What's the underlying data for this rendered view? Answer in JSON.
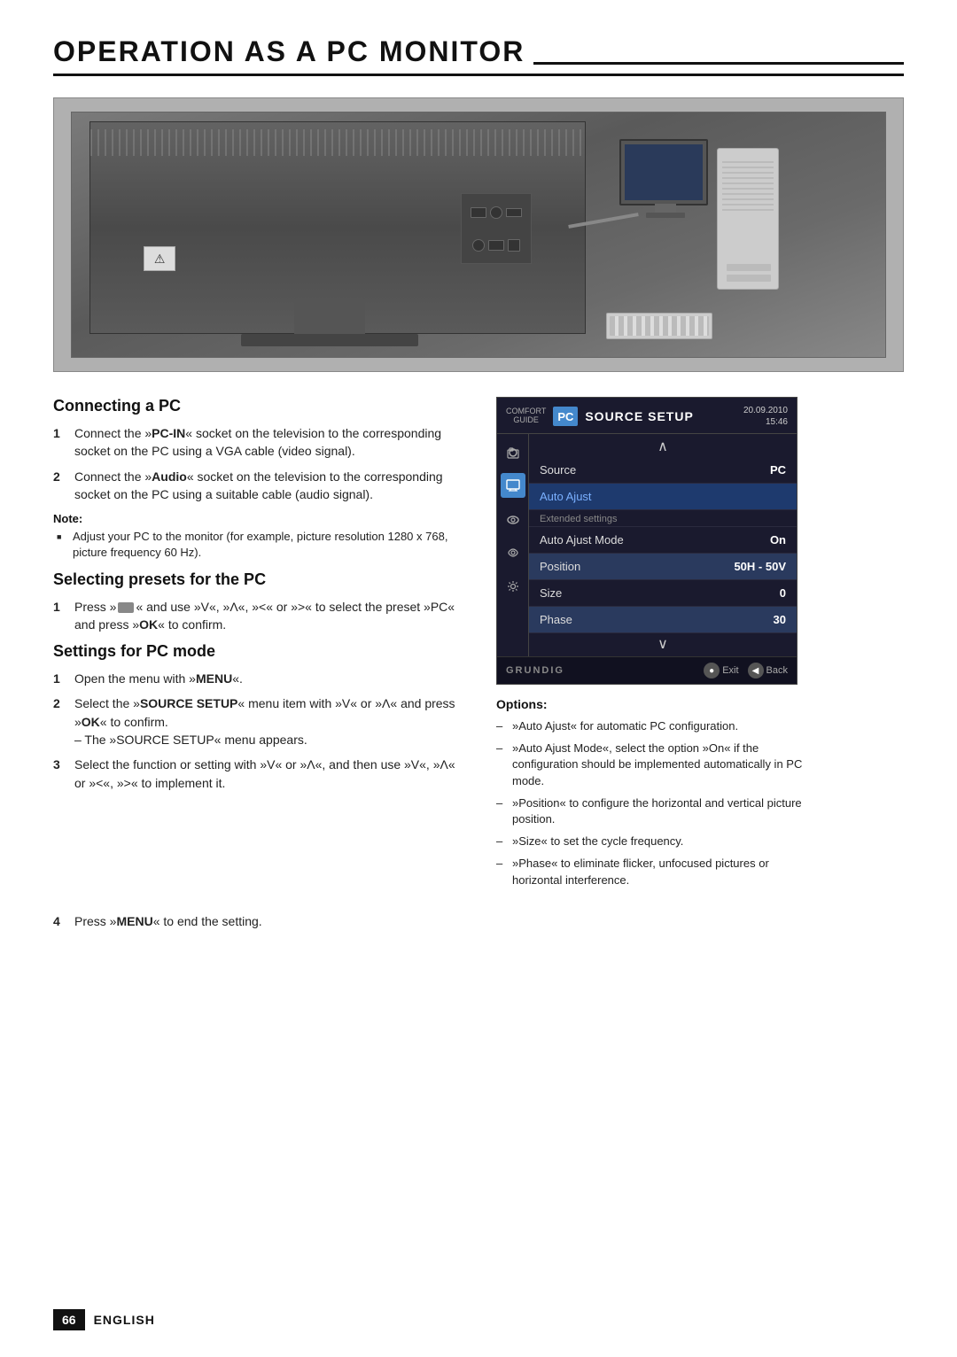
{
  "page": {
    "title": "OPERATION AS A PC MONITOR",
    "page_number": "66",
    "language": "ENGLISH"
  },
  "sections": {
    "connecting_pc": {
      "heading": "Connecting a PC",
      "steps": [
        {
          "num": "1",
          "text": "Connect the »PC-IN« socket on the television to the corresponding socket on the PC using a VGA cable (video signal)."
        },
        {
          "num": "2",
          "text": "Connect the »Audio« socket on the television to the corresponding socket on the PC using a suitable cable (audio signal)."
        }
      ],
      "note_label": "Note:",
      "note_text": "Adjust your PC to the monitor (for example, picture resolution 1280 x 768, picture frequency 60 Hz)."
    },
    "selecting_presets": {
      "heading": "Selecting presets for the PC",
      "steps": [
        {
          "num": "1",
          "text": "Press »   « and use »V«, »Λ«, »<« or »>« to select the preset »PC« and press »OK« to confirm."
        }
      ]
    },
    "settings_pc_mode": {
      "heading": "Settings for PC mode",
      "steps": [
        {
          "num": "1",
          "text": "Open the menu with »MENU«."
        },
        {
          "num": "2",
          "text": "Select the »SOURCE SETUP« menu item with »V« or »Λ« and press »OK« to confirm. – The »SOURCE SETUP« menu appears."
        },
        {
          "num": "3",
          "text": "Select the function or setting with »V« or »Λ«, and then use »V«, »Λ« or »<«, »>« to implement it."
        }
      ]
    }
  },
  "menu_panel": {
    "comfort_guide": "COMFORT\nGUIDE",
    "pc_label": "PC",
    "title": "SOURCE SETUP",
    "date": "20.09.2010",
    "time": "15:46",
    "arrow_up": "∧",
    "arrow_down": "∨",
    "rows": [
      {
        "label": "Source",
        "value": "PC",
        "highlighted": false
      },
      {
        "label": "Auto Ajust",
        "value": "",
        "highlighted": false,
        "type": "action"
      },
      {
        "label": "Extended settings",
        "value": "",
        "type": "section"
      },
      {
        "label": "Auto Ajust Mode",
        "value": "On",
        "highlighted": false
      },
      {
        "label": "Position",
        "value": "50H - 50V",
        "highlighted": true
      },
      {
        "label": "Size",
        "value": "0",
        "highlighted": false
      },
      {
        "label": "Phase",
        "value": "30",
        "highlighted": true
      }
    ],
    "footer_logo": "GRUNDIG",
    "footer_exit": "Exit",
    "footer_back": "Back"
  },
  "options": {
    "heading": "Options:",
    "items": [
      "»Auto Ajust« for automatic PC configuration.",
      "»Auto Ajust Mode«, select the option »On« if the configuration should be implemented automatically in PC mode.",
      "»Position« to configure the horizontal and vertical picture position.",
      "»Size« to set the cycle frequency.",
      "»Phase« to eliminate flicker, unfocused pictures or horizontal interference."
    ]
  },
  "step4": {
    "num": "4",
    "text": "Press »MENU« to end the setting."
  },
  "inline_bold": {
    "pc_in": "PC-IN",
    "audio": "Audio",
    "menu": "MENU",
    "ok": "OK",
    "source_setup": "SOURCE SETUP",
    "menu2": "MENU"
  }
}
